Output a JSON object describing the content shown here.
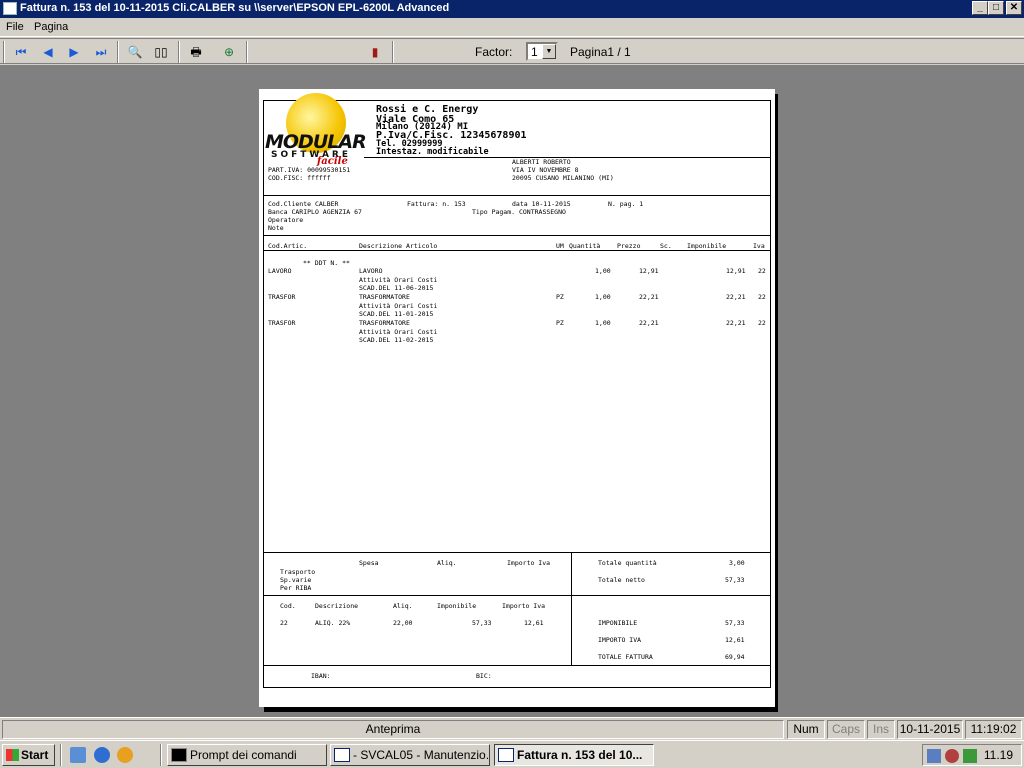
{
  "window": {
    "title": "Fattura n.  153 del 10-11-2015 Cli.CALBER su \\\\server\\EPSON EPL-6200L Advanced",
    "controls": {
      "minimize": "_",
      "maximize": "□",
      "close": "✕"
    }
  },
  "menu": {
    "file": "File",
    "pagina": "Pagina"
  },
  "toolbar": {
    "factor_label": "Factor:",
    "factor_value": "1",
    "page_label": "Pagina1 / 1",
    "icons": [
      "first-page-icon",
      "prev-page-icon",
      "next-page-icon",
      "last-page-icon",
      "zoom-icon",
      "two-pages-icon",
      "print-icon",
      "export-icon",
      "exit-icon"
    ]
  },
  "invoice": {
    "company": {
      "name": "Rossi e C. Energy",
      "street": "Viale Como 65",
      "city": "Milano  (20124)  MI",
      "vat": "P.Iva/C.Fisc. 12345678901",
      "phone": "Tel. 02999999",
      "custom": "Intestaz. modificabile"
    },
    "logo": {
      "line1": "MODULAR",
      "line2": "SOFTWARE",
      "line3": "facile"
    },
    "customer_ids": {
      "part_iva": "PART.IVA: 00099530151",
      "cod_fisc": "COD.FISC: ffffff"
    },
    "customer": {
      "name": "ALBERTI ROBERTO",
      "street": "VIA IV NOVEMBRE 8",
      "city": "20095 CUSANO MILANINO (MI)"
    },
    "info": {
      "cod_cliente": "Cod.Cliente CALBER",
      "fattura": "Fattura: n.   153",
      "data": "data 10-11-2015",
      "n_pag": "N. pag.   1",
      "banca": "Banca  CARIPLO AGENZIA 67",
      "tipo_pagam": "Tipo Pagam. CONTRASSEGNO",
      "operatore": "Operatore",
      "note": "Note"
    },
    "columns": {
      "cod": "Cod.Artic.",
      "descr": "Descrizione Articolo",
      "um": "UM",
      "qty": "Quantità",
      "prezzo": "Prezzo",
      "sc": "Sc.",
      "imponibile": "Imponibile",
      "iva": "Iva"
    },
    "ddt": "** DDT N. **",
    "rows": [
      {
        "cod": "LAVORO",
        "descr": "LAVORO",
        "um": "",
        "qty": "1,00",
        "prezzo": "12,91",
        "imponibile": "12,91",
        "iva": "22",
        "sub1": "Attività  Orari   Costi",
        "sub2": "SCAD.DEL 11-06-2015"
      },
      {
        "cod": "TRASFOR",
        "descr": "TRASFORMATORE",
        "um": "PZ",
        "qty": "1,00",
        "prezzo": "22,21",
        "imponibile": "22,21",
        "iva": "22",
        "sub1": "Attività  Orari   Costi",
        "sub2": "SCAD.DEL 11-01-2015"
      },
      {
        "cod": "TRASFOR",
        "descr": "TRASFORMATORE",
        "um": "PZ",
        "qty": "1,00",
        "prezzo": "22,21",
        "imponibile": "22,21",
        "iva": "22",
        "sub1": "Attività  Orari   Costi",
        "sub2": "SCAD.DEL 11-02-2015"
      }
    ],
    "footer": {
      "spesa": "Spesa",
      "aliq": "Aliq.",
      "importo_iva": "Importo Iva",
      "trasporto": "Trasporto",
      "sp_varie": "Sp.varie",
      "per_riba": "Per RIBA",
      "totale_quantita_label": "Totale quantità",
      "totale_quantita": "3,00",
      "totale_netto_label": "Totale netto",
      "totale_netto": "57,33",
      "vat_cols": {
        "cod": "Cod.",
        "descr": "Descrizione",
        "aliq": "Aliq.",
        "imponibile": "Imponibile",
        "importo": "Importo Iva"
      },
      "vat_row": {
        "cod": "22",
        "descr": "ALIQ. 22%",
        "aliq": "22,00",
        "imponibile": "57,33",
        "importo": "12,61"
      },
      "imponibile_label": "IMPONIBILE",
      "imponibile": "57,33",
      "importo_iva_label": "IMPORTO IVA",
      "importo_iva_val": "12,61",
      "totale_label": "TOTALE FATTURA",
      "totale": "69,94",
      "iban": "IBAN:",
      "bic": "BIC:"
    }
  },
  "status_bar": {
    "mode": "Anteprima",
    "num": "Num",
    "caps": "Caps",
    "ins": "Ins",
    "date": "10-11-2015",
    "time": "11:19:02"
  },
  "taskbar": {
    "start": "Start",
    "tasks": [
      "Prompt dei comandi",
      "- SVCAL05 - Manutenzio...",
      "Fattura n.  153 del 10..."
    ],
    "clock": "11.19"
  }
}
